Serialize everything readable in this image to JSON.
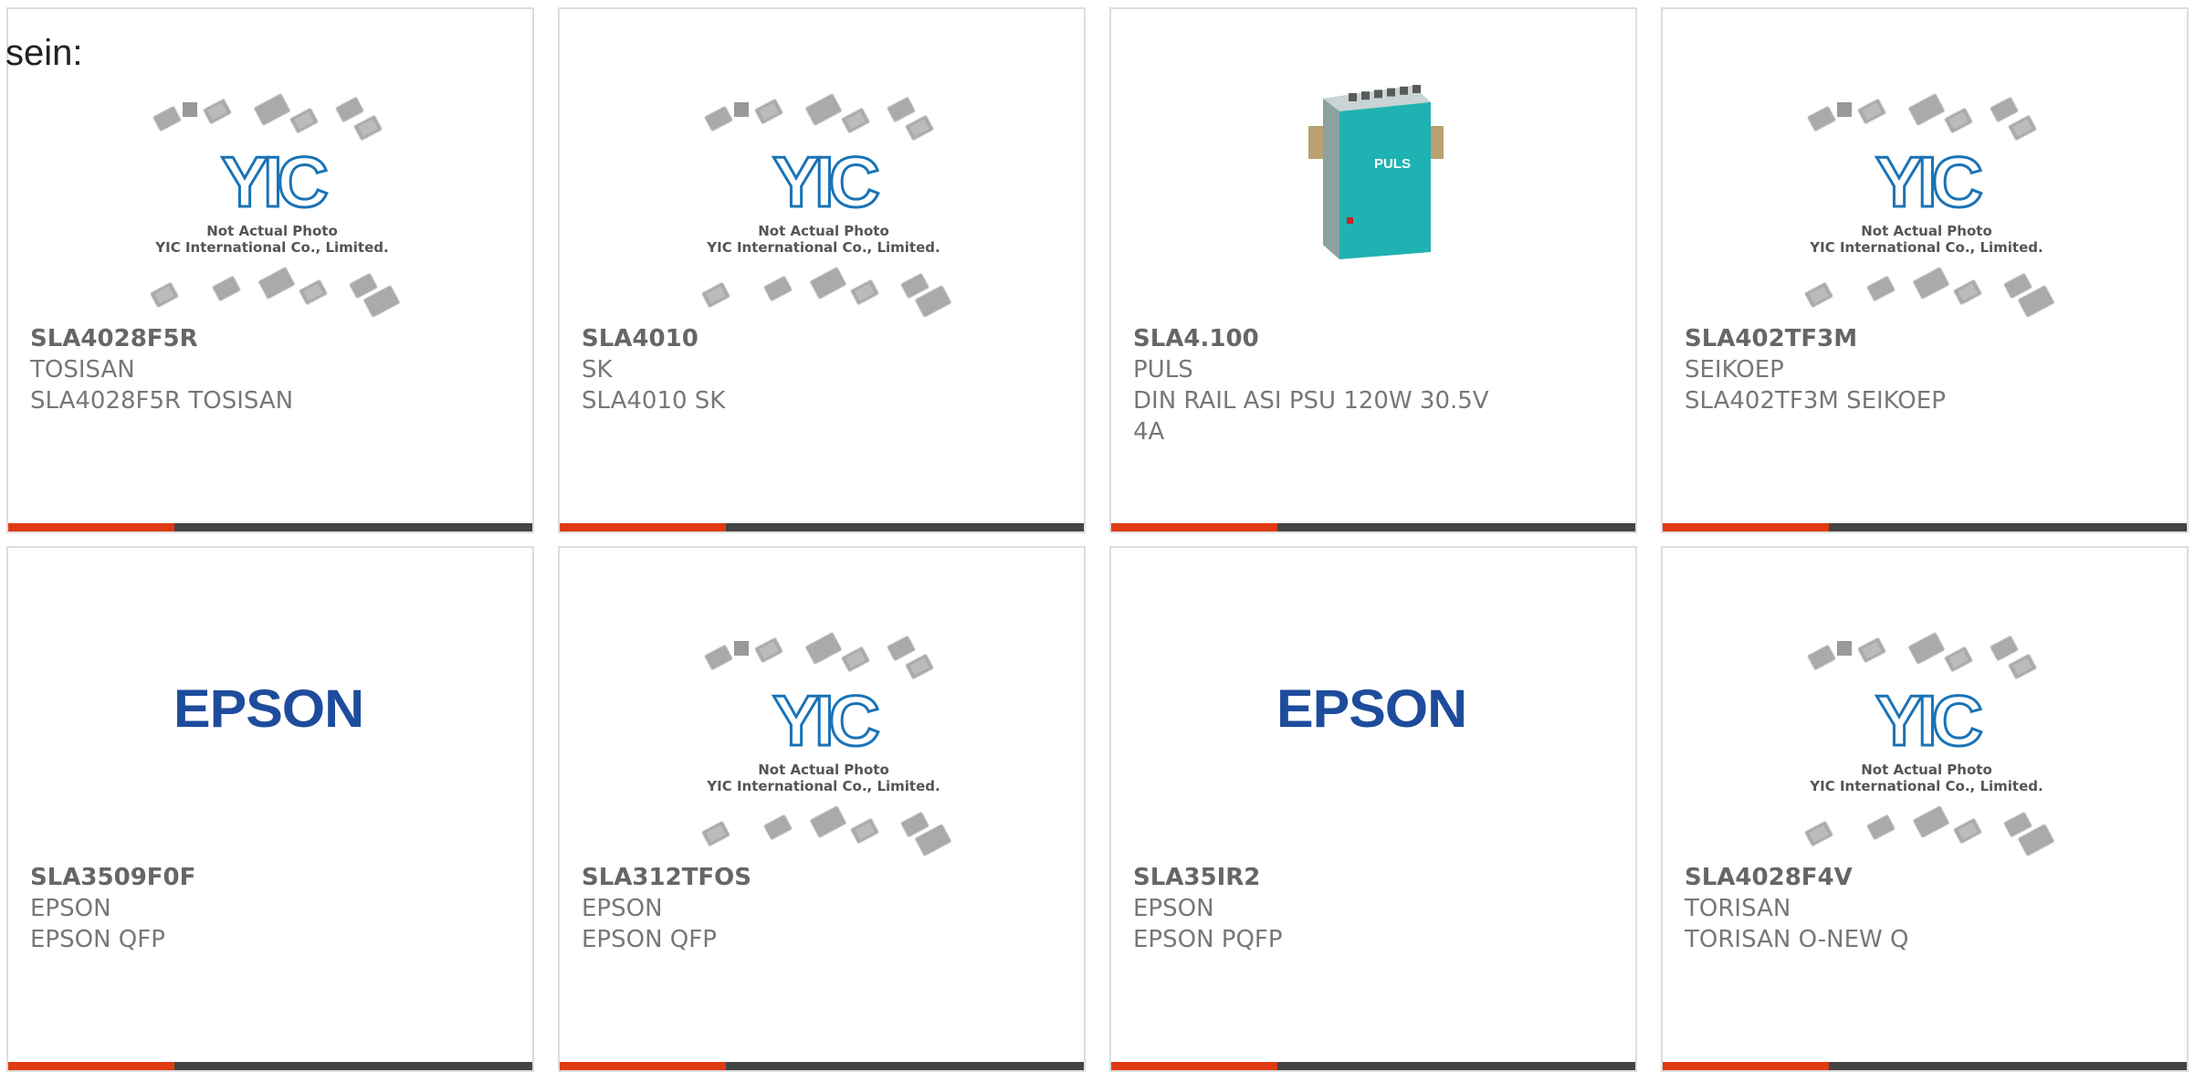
{
  "intro_text": "sein:",
  "colors": {
    "accent": "#e03a12",
    "bar_base": "#444444",
    "epson_blue": "#1e4c9c",
    "yic_blue": "#1a73b6",
    "puls_teal": "#1fb2b3"
  },
  "placeholder": {
    "line1": "Not Actual Photo",
    "line2": "YIC International Co., Limited.",
    "logo": "YIC"
  },
  "epson_logo": "EPSON",
  "puls_label": "PULS",
  "products": [
    {
      "part_number": "SLA4028F5R",
      "manufacturer": "TOSISAN",
      "description": "SLA4028F5R TOSISAN",
      "image": "yic-placeholder"
    },
    {
      "part_number": "SLA4010",
      "manufacturer": "SK",
      "description": "SLA4010 SK",
      "image": "yic-placeholder"
    },
    {
      "part_number": "SLA4.100",
      "manufacturer": "PULS",
      "description": "DIN RAIL ASI PSU 120W 30.5V 4A",
      "image": "puls-power-supply"
    },
    {
      "part_number": "SLA402TF3M",
      "manufacturer": "SEIKOEP",
      "description": "SLA402TF3M SEIKOEP",
      "image": "yic-placeholder"
    },
    {
      "part_number": "SLA3509F0F",
      "manufacturer": "EPSON",
      "description": "EPSON QFP",
      "image": "epson-logo"
    },
    {
      "part_number": "SLA312TFOS",
      "manufacturer": "EPSON",
      "description": "EPSON QFP",
      "image": "yic-placeholder"
    },
    {
      "part_number": "SLA35IR2",
      "manufacturer": "EPSON",
      "description": "EPSON PQFP",
      "image": "epson-logo"
    },
    {
      "part_number": "SLA4028F4V",
      "manufacturer": "TORISAN",
      "description": "TORISAN O-NEW Q",
      "image": "yic-placeholder"
    }
  ]
}
